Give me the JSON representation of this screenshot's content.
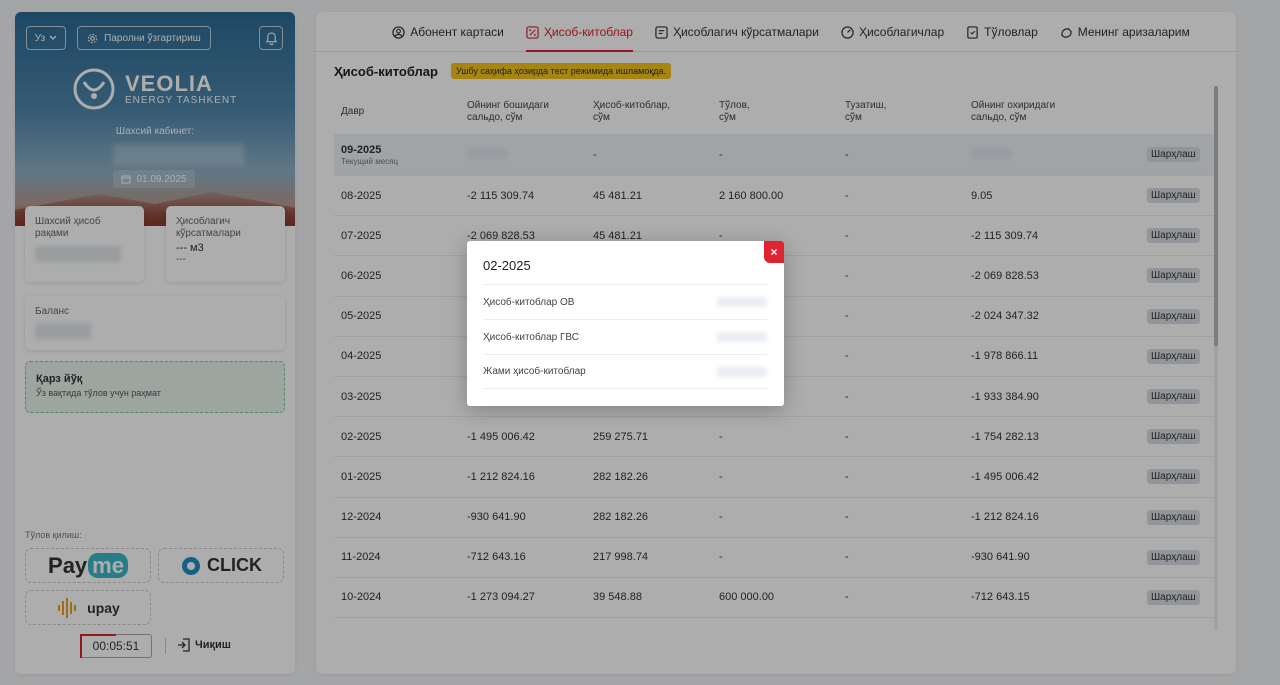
{
  "sidebar": {
    "lang": "Уз",
    "change_password": "Паролни ўзгартириш",
    "logo_title": "VEOLIA",
    "logo_subtitle": "ENERGY TASHKENT",
    "cabinet_label": "Шахсий кабинет:",
    "date": "01.09.2025",
    "account_label": "Шахсий ҳисоб рақами",
    "meter_label": "Ҳисоблагич кўрсатмалари",
    "meter_value": "--- м3",
    "meter_sub": "---",
    "balance_label": "Баланс",
    "debt_title": "Қарз йўқ",
    "debt_sub": "Ўз вақтида тўлов учун раҳмат",
    "pay_label": "Тўлов қилиш:",
    "payme": "Payme",
    "click": "CLICK",
    "upay": "upay",
    "timer": "00:05:51",
    "logout": "Чиқиш"
  },
  "tabs": [
    {
      "label": "Абонент картаси",
      "icon": "user-circle-icon"
    },
    {
      "label": "Ҳисоб-китоблар",
      "icon": "percent-icon"
    },
    {
      "label": "Ҳисоблагич кўрсатмалари",
      "icon": "reading-icon"
    },
    {
      "label": "Ҳисоблагичлар",
      "icon": "meter-icon"
    },
    {
      "label": "Тўловлар",
      "icon": "payment-icon"
    },
    {
      "label": "Менинг аризаларим",
      "icon": "applications-icon"
    }
  ],
  "main": {
    "title": "Ҳисоб-китоблар",
    "test_notice": "Ушбу саҳифа ҳозирда тест режимида ишламоқда.",
    "columns": [
      "Давр",
      "Ойнинг бошидаги\nсальдо, сўм",
      "Ҳисоб-китоблар,\nсўм",
      "Тўлов,\nсўм",
      "Тузатиш,\nсўм",
      "Ойнинг охиридаги\nсальдо, сўм"
    ],
    "current_period": {
      "period": "09-2025",
      "sub": "Текущий месяц",
      "charges": "-",
      "payment": "-",
      "adjust": "-",
      "comment": "Шарҳлаш"
    },
    "rows": [
      {
        "period": "08-2025",
        "start": "-2 115 309.74",
        "charges": "45 481.21",
        "payment": "2 160 800.00",
        "adjust": "-",
        "end": "9.05",
        "comment": "Шарҳлаш"
      },
      {
        "period": "07-2025",
        "start": "-2 069 828.53",
        "charges": "45 481.21",
        "payment": "-",
        "adjust": "-",
        "end": "-2 115 309.74",
        "comment": "Шарҳлаш"
      },
      {
        "period": "06-2025",
        "start": "",
        "charges": "",
        "payment": "",
        "adjust": "-",
        "end": "-2 069 828.53",
        "comment": "Шарҳлаш"
      },
      {
        "period": "05-2025",
        "start": "",
        "charges": "",
        "payment": "",
        "adjust": "-",
        "end": "-2 024 347.32",
        "comment": "Шарҳлаш"
      },
      {
        "period": "04-2025",
        "start": "",
        "charges": "",
        "payment": "",
        "adjust": "-",
        "end": "-1 978 866.11",
        "comment": "Шарҳлаш"
      },
      {
        "period": "03-2025",
        "start": "",
        "charges": "",
        "payment": "",
        "adjust": "-",
        "end": "-1 933 384.90",
        "comment": "Шарҳлаш"
      },
      {
        "period": "02-2025",
        "start": "-1 495 006.42",
        "charges": "259 275.71",
        "payment": "-",
        "adjust": "-",
        "end": "-1 754 282.13",
        "comment": "Шарҳлаш"
      },
      {
        "period": "01-2025",
        "start": "-1 212 824.16",
        "charges": "282 182.26",
        "payment": "-",
        "adjust": "-",
        "end": "-1 495 006.42",
        "comment": "Шарҳлаш"
      },
      {
        "period": "12-2024",
        "start": "-930 641.90",
        "charges": "282 182.26",
        "payment": "-",
        "adjust": "-",
        "end": "-1 212 824.16",
        "comment": "Шарҳлаш"
      },
      {
        "period": "11-2024",
        "start": "-712 643.16",
        "charges": "217 998.74",
        "payment": "-",
        "adjust": "-",
        "end": "-930 641.90",
        "comment": "Шарҳлаш"
      },
      {
        "period": "10-2024",
        "start": "-1 273 094.27",
        "charges": "39 548.88",
        "payment": "600 000.00",
        "adjust": "-",
        "end": "-712 643.15",
        "comment": "Шарҳлаш"
      }
    ]
  },
  "modal": {
    "title": "02-2025",
    "close": "×",
    "rows": [
      "Ҳисоб-китоблар ОВ",
      "Ҳисоб-китоблар ГВС",
      "Жами ҳисоб-китоблар"
    ]
  },
  "colors": {
    "accent": "#d9232d",
    "test_badge": "#f5c518",
    "debt_bg": "#e6f3ec"
  }
}
